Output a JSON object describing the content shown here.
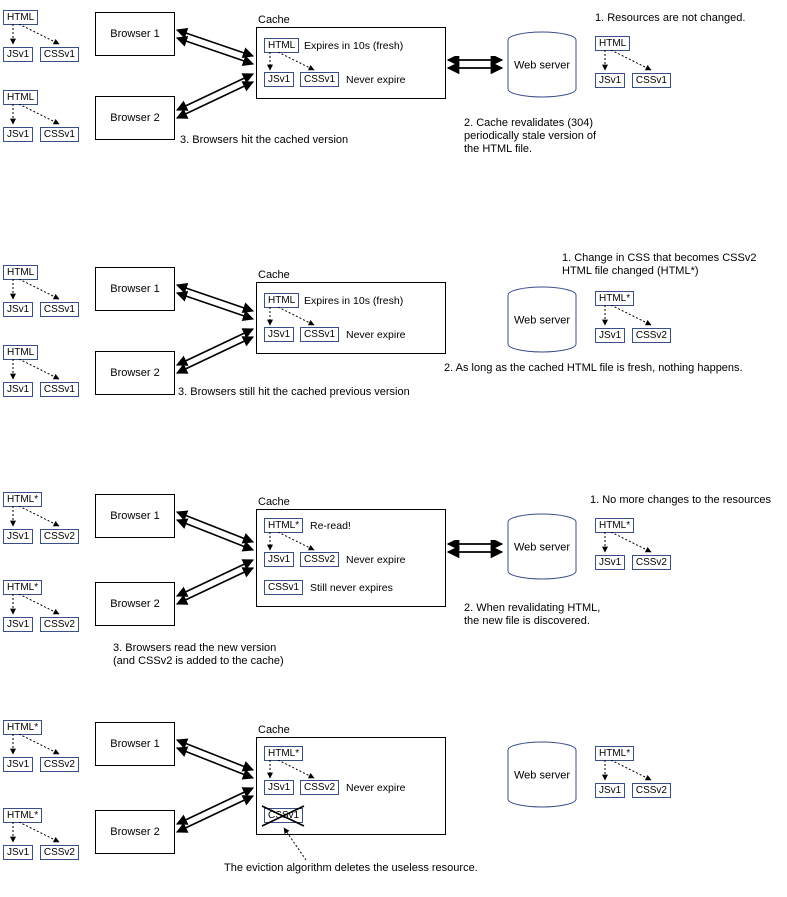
{
  "labels": {
    "browser1": "Browser 1",
    "browser2": "Browser 2",
    "cache": "Cache",
    "webserver": "Web server",
    "html": "HTML",
    "html_star": "HTML*",
    "jsv1": "JSv1",
    "cssv1": "CSSv1",
    "cssv2": "CSSv2"
  },
  "panel1": {
    "cache_line1_status": "Expires in 10s (fresh)",
    "cache_line2_status": "Never expire",
    "note1": "1. Resources are not changed.",
    "note2a": "2. Cache revalidates (304)",
    "note2b": "periodically stale version of",
    "note2c": "the HTML file.",
    "note3": "3. Browsers hit the cached version"
  },
  "panel2": {
    "cache_line1_status": "Expires in 10s (fresh)",
    "cache_line2_status": "Never expire",
    "note1a": "1. Change in CSS that becomes CSSv2",
    "note1b": "HTML file changed (HTML*)",
    "note2": "2. As long as the cached HTML file is fresh, nothing happens.",
    "note3": "3. Browsers still hit the cached previous version"
  },
  "panel3": {
    "cache_line1_status": "Re-read!",
    "cache_line2_status": "Never expire",
    "cache_line3_status": "Still never expires",
    "note1": "1. No more changes to the resources",
    "note2a": "2. When revalidating HTML,",
    "note2b": "the new file is discovered.",
    "note3a": "3. Browsers read the new version",
    "note3b": "(and CSSv2 is added to the cache)"
  },
  "panel4": {
    "cache_line2_status": "Never expire",
    "note_eviction": "The eviction algorithm deletes the useless resource."
  }
}
